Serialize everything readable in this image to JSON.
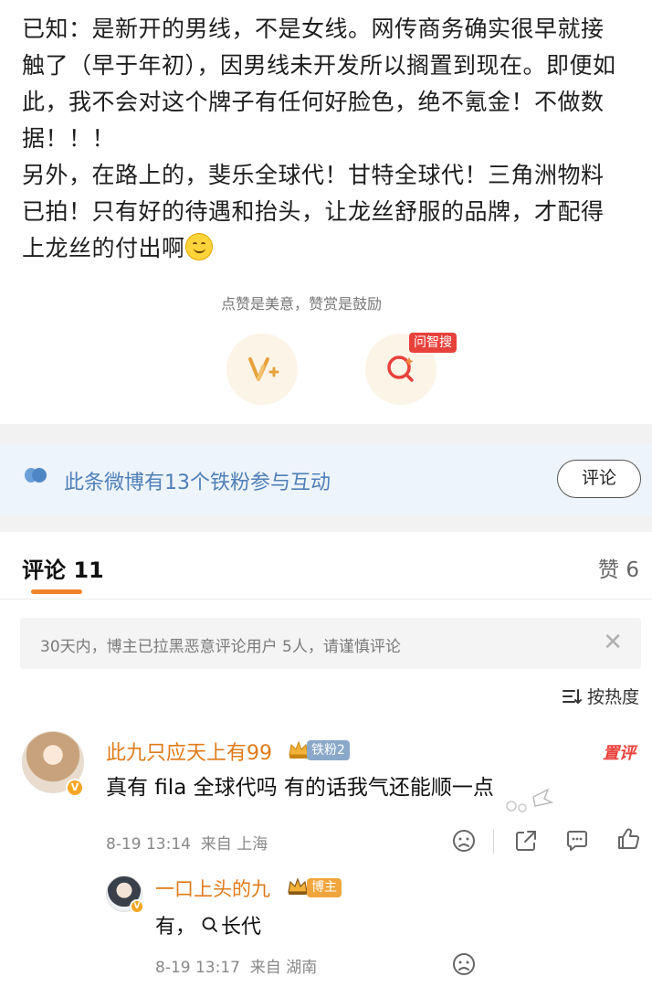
{
  "post": {
    "lines": [
      "已知：是新开的男线，不是女线。网传商务确实很早就接",
      "触了（早于年初），因男线未开发所以搁置到现在。即便如",
      "此，我不会对这个牌子有任何好脸色，绝不氪金！不做数",
      "据！！！",
      "另外，在路上的，斐乐全球代！甘特全球代！三角洲物料",
      "已拍！只有好的待遇和抬头，让龙丝舒服的品牌，才配得",
      "上龙丝的付出啊"
    ],
    "emoji_name": "smile-emoji"
  },
  "reward": {
    "hint": "点赞是美意，赞赏是鼓励",
    "ask_badge": "问智搜"
  },
  "fans_bar": {
    "text": "此条微博有13个铁粉参与互动",
    "comment_button": "评论"
  },
  "tabs": {
    "comments": "评论 11",
    "likes": "赞 6"
  },
  "notice": {
    "text": "30天内，博主已拉黑恶意评论用户 5人，请谨慎评论",
    "close": "✕"
  },
  "sort": {
    "label": "按热度"
  },
  "comments": [
    {
      "name": "此九只应天上有99",
      "badge": "铁粉2",
      "tag": "置评",
      "text": "真有 fila 全球代吗 有的话我气还能顺一点",
      "time": "8-19 13:14",
      "location": "来自 上海",
      "vip": "V"
    }
  ],
  "reply": {
    "name": "一口上头的九",
    "badge": "博主",
    "text_prefix": "有，",
    "search_term": "长代",
    "time": "8-19 13:17",
    "location": "来自 湖南",
    "vip": "V"
  },
  "colors": {
    "accent_orange": "#f0842c",
    "username": "#e07b1a",
    "link_blue": "#4f7fb8",
    "top_tag_red": "#e8413b"
  }
}
